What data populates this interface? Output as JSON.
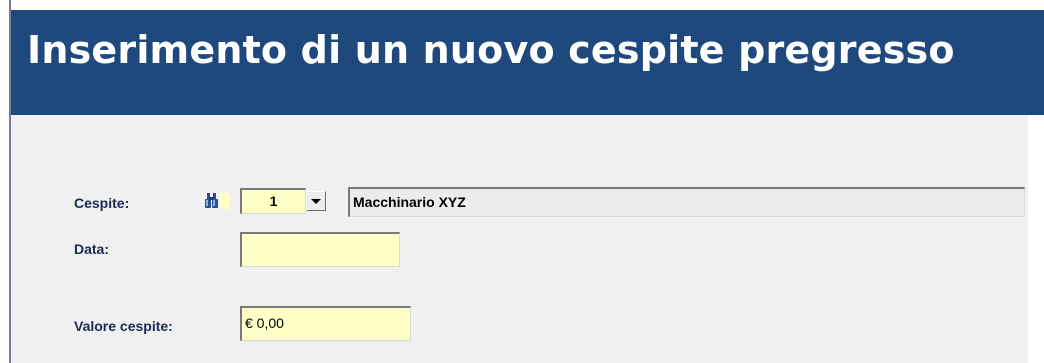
{
  "header": {
    "title": "Inserimento di un nuovo cespite pregresso"
  },
  "form": {
    "cespite": {
      "label": "Cespite:",
      "search_icon": "binoculars-icon",
      "code_value": "1",
      "description_value": "Macchinario XYZ"
    },
    "data": {
      "label": "Data:",
      "value": ""
    },
    "valore_cespite": {
      "label": "Valore cespite:",
      "value": "€ 0,00"
    }
  },
  "colors": {
    "header_background": "#1f497d",
    "header_text": "#ffffff",
    "content_background": "#f0f0f0",
    "label_text": "#1a2a55",
    "input_yellow": "#ffffc8",
    "input_grey": "#ececec"
  }
}
